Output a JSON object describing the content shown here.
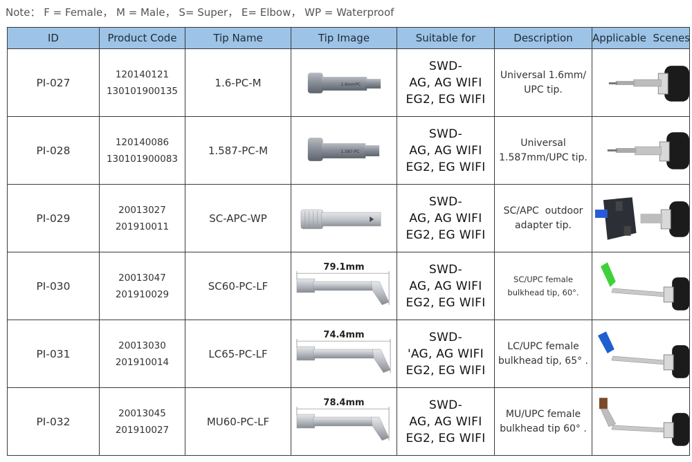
{
  "note": "Note： F = Female， M = Male， S= Super， E= Elbow， WP = Waterproof",
  "headers": [
    "ID",
    "Product Code",
    "Tip Name",
    "Tip Image",
    "Suitable for",
    "Description",
    "Applicable  Scenes"
  ],
  "rows": [
    {
      "id": "PI-027",
      "codes": [
        "120140121",
        "130101900135"
      ],
      "tip": "1.6-PC-M",
      "tip_image_text": "1.6mmPC",
      "dim": "",
      "suit": [
        "SWD-",
        "AG, AG WIFI",
        "EG2, EG WIFI"
      ],
      "desc": [
        "Universal 1.6mm/",
        "UPC tip."
      ]
    },
    {
      "id": "PI-028",
      "codes": [
        "120140086",
        "130101900083"
      ],
      "tip": "1.587-PC-M",
      "tip_image_text": "1.587-PC",
      "dim": "",
      "suit": [
        "SWD-",
        "AG, AG WIFI",
        "EG2, EG WIFI"
      ],
      "desc": [
        "Universal",
        "1.587mm/UPC tip."
      ]
    },
    {
      "id": "PI-029",
      "codes": [
        "20013027",
        "201910011"
      ],
      "tip": "SC-APC-WP",
      "tip_image_text": "",
      "dim": "",
      "suit": [
        "SWD-",
        "AG, AG WIFI",
        "EG2, EG WIFI"
      ],
      "desc": [
        "SC/APC  outdoor",
        "adapter tip."
      ]
    },
    {
      "id": "PI-030",
      "codes": [
        "20013047",
        "201910029"
      ],
      "tip": "SC60-PC-LF",
      "tip_image_text": "",
      "dim": "79.1mm",
      "suit": [
        "SWD-",
        "AG, AG WIFI",
        "EG2, EG WIFI"
      ],
      "desc": [
        "SC/UPC female",
        "bulkhead tip, 60°."
      ]
    },
    {
      "id": "PI-031",
      "codes": [
        "20013030",
        "201910014"
      ],
      "tip": "LC65-PC-LF",
      "tip_image_text": "",
      "dim": "74.4mm",
      "suit": [
        "SWD-",
        "'AG, AG WIFI",
        "EG2, EG WIFI"
      ],
      "desc": [
        "LC/UPC female",
        "bulkhead tip, 65° ."
      ]
    },
    {
      "id": "PI-032",
      "codes": [
        "20013045",
        "201910027"
      ],
      "tip": "MU60-PC-LF",
      "tip_image_text": "",
      "dim": "78.4mm",
      "suit": [
        "SWD-",
        "AG, AG WIFI",
        "EG2, EG WIFI"
      ],
      "desc": [
        "MU/UPC female",
        "bulkhead tip 60° ."
      ]
    }
  ],
  "colors": {
    "header_bg": "#9dc3e6",
    "border": "#3a3a3a"
  }
}
